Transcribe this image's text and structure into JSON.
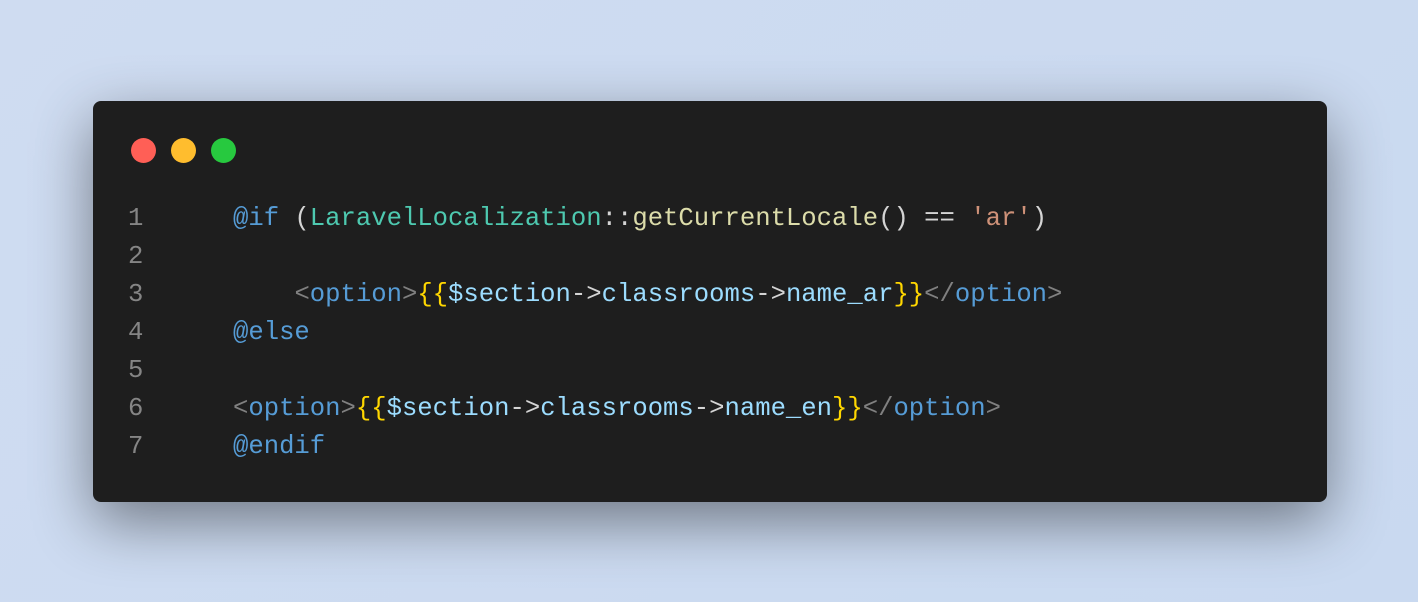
{
  "window": {
    "controls": [
      {
        "name": "close",
        "color": "#ff5f56"
      },
      {
        "name": "minimize",
        "color": "#ffbd2e"
      },
      {
        "name": "maximize",
        "color": "#27c93f"
      }
    ]
  },
  "code": {
    "lines": [
      {
        "number": "1",
        "indent": "",
        "tokens": [
          [
            "kw",
            "@if"
          ],
          [
            "txt",
            " ("
          ],
          [
            "cls",
            "LaravelLocalization"
          ],
          [
            "txt",
            "::"
          ],
          [
            "fn",
            "getCurrentLocale"
          ],
          [
            "txt",
            "() == "
          ],
          [
            "str",
            "'ar'"
          ],
          [
            "txt",
            ")"
          ]
        ]
      },
      {
        "number": "2",
        "indent": "",
        "tokens": []
      },
      {
        "number": "3",
        "indent": "    ",
        "tokens": [
          [
            "tag",
            "<"
          ],
          [
            "kw",
            "option"
          ],
          [
            "tag",
            ">"
          ],
          [
            "br",
            "{{"
          ],
          [
            "var",
            "$section"
          ],
          [
            "txt",
            "->"
          ],
          [
            "var",
            "classrooms"
          ],
          [
            "txt",
            "->"
          ],
          [
            "var",
            "name_ar"
          ],
          [
            "br",
            "}}"
          ],
          [
            "tag",
            "</"
          ],
          [
            "kw",
            "option"
          ],
          [
            "tag",
            ">"
          ]
        ]
      },
      {
        "number": "4",
        "indent": "",
        "tokens": [
          [
            "kw",
            "@else"
          ]
        ]
      },
      {
        "number": "5",
        "indent": "",
        "tokens": []
      },
      {
        "number": "6",
        "indent": "",
        "tokens": [
          [
            "tag",
            "<"
          ],
          [
            "kw",
            "option"
          ],
          [
            "tag",
            ">"
          ],
          [
            "br",
            "{{"
          ],
          [
            "var",
            "$section"
          ],
          [
            "txt",
            "->"
          ],
          [
            "var",
            "classrooms"
          ],
          [
            "txt",
            "->"
          ],
          [
            "var",
            "name_en"
          ],
          [
            "br",
            "}}"
          ],
          [
            "tag",
            "</"
          ],
          [
            "kw",
            "option"
          ],
          [
            "tag",
            ">"
          ]
        ]
      },
      {
        "number": "7",
        "indent": "",
        "tokens": [
          [
            "kw",
            "@endif"
          ]
        ]
      }
    ]
  }
}
